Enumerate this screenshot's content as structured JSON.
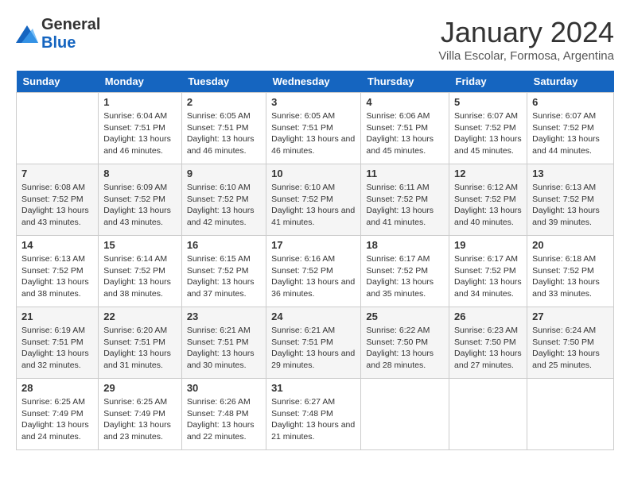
{
  "logo": {
    "general": "General",
    "blue": "Blue"
  },
  "title": "January 2024",
  "subtitle": "Villa Escolar, Formosa, Argentina",
  "headers": [
    "Sunday",
    "Monday",
    "Tuesday",
    "Wednesday",
    "Thursday",
    "Friday",
    "Saturday"
  ],
  "weeks": [
    [
      {
        "day": "",
        "sunrise": "",
        "sunset": "",
        "daylight": ""
      },
      {
        "day": "1",
        "sunrise": "Sunrise: 6:04 AM",
        "sunset": "Sunset: 7:51 PM",
        "daylight": "Daylight: 13 hours and 46 minutes."
      },
      {
        "day": "2",
        "sunrise": "Sunrise: 6:05 AM",
        "sunset": "Sunset: 7:51 PM",
        "daylight": "Daylight: 13 hours and 46 minutes."
      },
      {
        "day": "3",
        "sunrise": "Sunrise: 6:05 AM",
        "sunset": "Sunset: 7:51 PM",
        "daylight": "Daylight: 13 hours and 46 minutes."
      },
      {
        "day": "4",
        "sunrise": "Sunrise: 6:06 AM",
        "sunset": "Sunset: 7:51 PM",
        "daylight": "Daylight: 13 hours and 45 minutes."
      },
      {
        "day": "5",
        "sunrise": "Sunrise: 6:07 AM",
        "sunset": "Sunset: 7:52 PM",
        "daylight": "Daylight: 13 hours and 45 minutes."
      },
      {
        "day": "6",
        "sunrise": "Sunrise: 6:07 AM",
        "sunset": "Sunset: 7:52 PM",
        "daylight": "Daylight: 13 hours and 44 minutes."
      }
    ],
    [
      {
        "day": "7",
        "sunrise": "Sunrise: 6:08 AM",
        "sunset": "Sunset: 7:52 PM",
        "daylight": "Daylight: 13 hours and 43 minutes."
      },
      {
        "day": "8",
        "sunrise": "Sunrise: 6:09 AM",
        "sunset": "Sunset: 7:52 PM",
        "daylight": "Daylight: 13 hours and 43 minutes."
      },
      {
        "day": "9",
        "sunrise": "Sunrise: 6:10 AM",
        "sunset": "Sunset: 7:52 PM",
        "daylight": "Daylight: 13 hours and 42 minutes."
      },
      {
        "day": "10",
        "sunrise": "Sunrise: 6:10 AM",
        "sunset": "Sunset: 7:52 PM",
        "daylight": "Daylight: 13 hours and 41 minutes."
      },
      {
        "day": "11",
        "sunrise": "Sunrise: 6:11 AM",
        "sunset": "Sunset: 7:52 PM",
        "daylight": "Daylight: 13 hours and 41 minutes."
      },
      {
        "day": "12",
        "sunrise": "Sunrise: 6:12 AM",
        "sunset": "Sunset: 7:52 PM",
        "daylight": "Daylight: 13 hours and 40 minutes."
      },
      {
        "day": "13",
        "sunrise": "Sunrise: 6:13 AM",
        "sunset": "Sunset: 7:52 PM",
        "daylight": "Daylight: 13 hours and 39 minutes."
      }
    ],
    [
      {
        "day": "14",
        "sunrise": "Sunrise: 6:13 AM",
        "sunset": "Sunset: 7:52 PM",
        "daylight": "Daylight: 13 hours and 38 minutes."
      },
      {
        "day": "15",
        "sunrise": "Sunrise: 6:14 AM",
        "sunset": "Sunset: 7:52 PM",
        "daylight": "Daylight: 13 hours and 38 minutes."
      },
      {
        "day": "16",
        "sunrise": "Sunrise: 6:15 AM",
        "sunset": "Sunset: 7:52 PM",
        "daylight": "Daylight: 13 hours and 37 minutes."
      },
      {
        "day": "17",
        "sunrise": "Sunrise: 6:16 AM",
        "sunset": "Sunset: 7:52 PM",
        "daylight": "Daylight: 13 hours and 36 minutes."
      },
      {
        "day": "18",
        "sunrise": "Sunrise: 6:17 AM",
        "sunset": "Sunset: 7:52 PM",
        "daylight": "Daylight: 13 hours and 35 minutes."
      },
      {
        "day": "19",
        "sunrise": "Sunrise: 6:17 AM",
        "sunset": "Sunset: 7:52 PM",
        "daylight": "Daylight: 13 hours and 34 minutes."
      },
      {
        "day": "20",
        "sunrise": "Sunrise: 6:18 AM",
        "sunset": "Sunset: 7:52 PM",
        "daylight": "Daylight: 13 hours and 33 minutes."
      }
    ],
    [
      {
        "day": "21",
        "sunrise": "Sunrise: 6:19 AM",
        "sunset": "Sunset: 7:51 PM",
        "daylight": "Daylight: 13 hours and 32 minutes."
      },
      {
        "day": "22",
        "sunrise": "Sunrise: 6:20 AM",
        "sunset": "Sunset: 7:51 PM",
        "daylight": "Daylight: 13 hours and 31 minutes."
      },
      {
        "day": "23",
        "sunrise": "Sunrise: 6:21 AM",
        "sunset": "Sunset: 7:51 PM",
        "daylight": "Daylight: 13 hours and 30 minutes."
      },
      {
        "day": "24",
        "sunrise": "Sunrise: 6:21 AM",
        "sunset": "Sunset: 7:51 PM",
        "daylight": "Daylight: 13 hours and 29 minutes."
      },
      {
        "day": "25",
        "sunrise": "Sunrise: 6:22 AM",
        "sunset": "Sunset: 7:50 PM",
        "daylight": "Daylight: 13 hours and 28 minutes."
      },
      {
        "day": "26",
        "sunrise": "Sunrise: 6:23 AM",
        "sunset": "Sunset: 7:50 PM",
        "daylight": "Daylight: 13 hours and 27 minutes."
      },
      {
        "day": "27",
        "sunrise": "Sunrise: 6:24 AM",
        "sunset": "Sunset: 7:50 PM",
        "daylight": "Daylight: 13 hours and 25 minutes."
      }
    ],
    [
      {
        "day": "28",
        "sunrise": "Sunrise: 6:25 AM",
        "sunset": "Sunset: 7:49 PM",
        "daylight": "Daylight: 13 hours and 24 minutes."
      },
      {
        "day": "29",
        "sunrise": "Sunrise: 6:25 AM",
        "sunset": "Sunset: 7:49 PM",
        "daylight": "Daylight: 13 hours and 23 minutes."
      },
      {
        "day": "30",
        "sunrise": "Sunrise: 6:26 AM",
        "sunset": "Sunset: 7:48 PM",
        "daylight": "Daylight: 13 hours and 22 minutes."
      },
      {
        "day": "31",
        "sunrise": "Sunrise: 6:27 AM",
        "sunset": "Sunset: 7:48 PM",
        "daylight": "Daylight: 13 hours and 21 minutes."
      },
      {
        "day": "",
        "sunrise": "",
        "sunset": "",
        "daylight": ""
      },
      {
        "day": "",
        "sunrise": "",
        "sunset": "",
        "daylight": ""
      },
      {
        "day": "",
        "sunrise": "",
        "sunset": "",
        "daylight": ""
      }
    ]
  ]
}
